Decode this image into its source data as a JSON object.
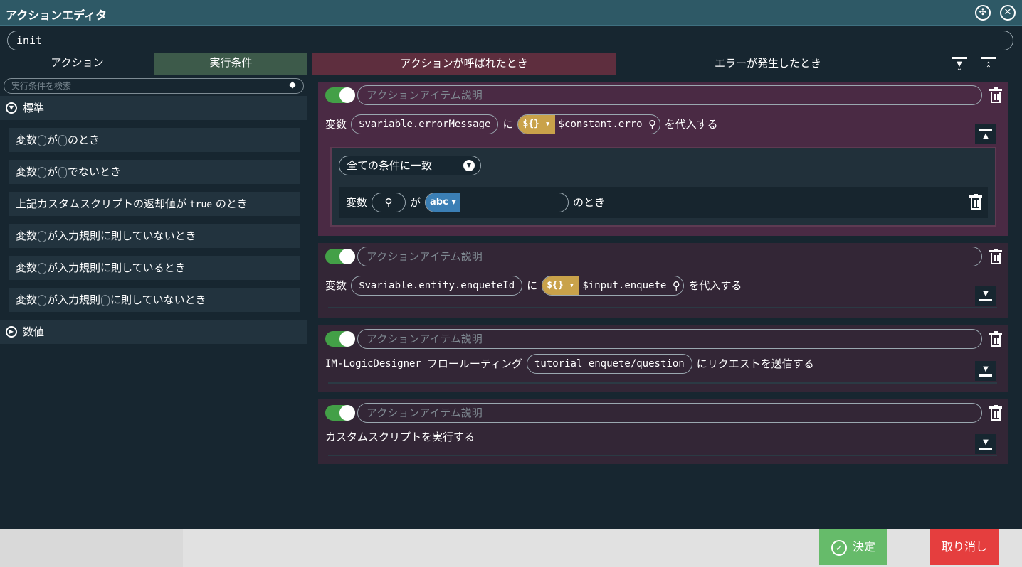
{
  "window": {
    "title": "アクションエディタ",
    "pin_icon": "pin-icon",
    "close_icon": "close-icon"
  },
  "name_input": {
    "value": "init"
  },
  "left_tabs": {
    "action": "アクション",
    "condition": "実行条件"
  },
  "search": {
    "placeholder": "実行条件を検索"
  },
  "groups": {
    "standard": "標準",
    "numeric": "数値"
  },
  "conditions": [
    {
      "a": "変数",
      "b": "が",
      "c": "のとき"
    },
    {
      "a": "変数",
      "b": "が",
      "c": "でないとき"
    },
    {
      "a": "上記カスタムスクリプトの返却値が",
      "mono": "true",
      "c": "のとき"
    },
    {
      "a": "変数",
      "b": "が入力規則に則していないとき"
    },
    {
      "a": "変数",
      "b": "が入力規則に則しているとき"
    },
    {
      "a": "変数",
      "b": "が入力規則",
      "c": "に則していないとき"
    }
  ],
  "right_tabs": {
    "called": "アクションが呼ばれたとき",
    "error": "エラーが発生したとき"
  },
  "cards": [
    {
      "desc_placeholder": "アクションアイテム説明",
      "label_var": "変数",
      "variable": "$variable.errorMessage",
      "ni": "に",
      "tag": "${}",
      "value": "$constant.erro",
      "suffix": "を代入する",
      "cond": {
        "match": "全ての条件に一致",
        "label_var": "変数",
        "ga": "が",
        "type_tag": "abc",
        "suffix": "のとき"
      }
    },
    {
      "desc_placeholder": "アクションアイテム説明",
      "label_var": "変数",
      "variable": "$variable.entity.enqueteId",
      "ni": "に",
      "tag": "${}",
      "value": "$input.enquete",
      "suffix": "を代入する"
    },
    {
      "desc_placeholder": "アクションアイテム説明",
      "prefix": "IM-LogicDesigner",
      "flow": "フロールーティング",
      "route": "tutorial_enquete/question",
      "suffix": "にリクエストを送信する"
    },
    {
      "desc_placeholder": "アクションアイテム説明",
      "text": "カスタムスクリプトを実行する"
    }
  ],
  "footer": {
    "ok": "決定",
    "cancel": "取り消し"
  },
  "colors": {
    "title_bar": "#2e5966",
    "called_tab": "#5e2e3e",
    "condition_tab": "#3d5a4a",
    "ok": "#66bb6a",
    "cancel": "#e53e3e",
    "toggle": "#43a047",
    "var_tag": "#c9a24a",
    "type_tag": "#3b7fb5"
  }
}
